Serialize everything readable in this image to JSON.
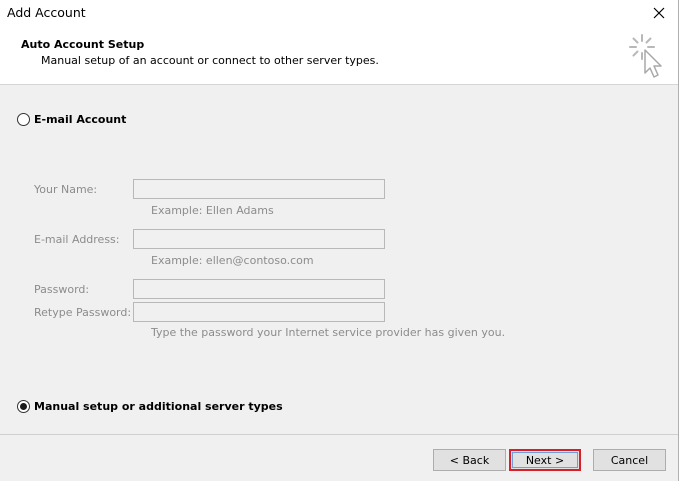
{
  "window": {
    "title": "Add Account"
  },
  "header": {
    "title": "Auto Account Setup",
    "subtitle": "Manual setup of an account or connect to other server types.",
    "icon": "wizard-cursor-icon"
  },
  "email_account": {
    "label": "E-mail Account",
    "selected": false,
    "fields": {
      "name": {
        "label": "Your Name:",
        "value": "",
        "hint": "Example: Ellen Adams"
      },
      "email": {
        "label": "E-mail Address:",
        "value": "",
        "hint": "Example: ellen@contoso.com"
      },
      "password": {
        "label": "Password:",
        "value": ""
      },
      "retype_password": {
        "label": "Retype Password:",
        "value": "",
        "hint": "Type the password your Internet service provider has given you."
      }
    }
  },
  "manual_setup": {
    "label": "Manual setup or additional server types",
    "selected": true
  },
  "buttons": {
    "back": "< Back",
    "next": "Next >",
    "cancel": "Cancel"
  },
  "colors": {
    "highlight_border": "#d9202a",
    "disabled_text": "#8c8c8c"
  }
}
